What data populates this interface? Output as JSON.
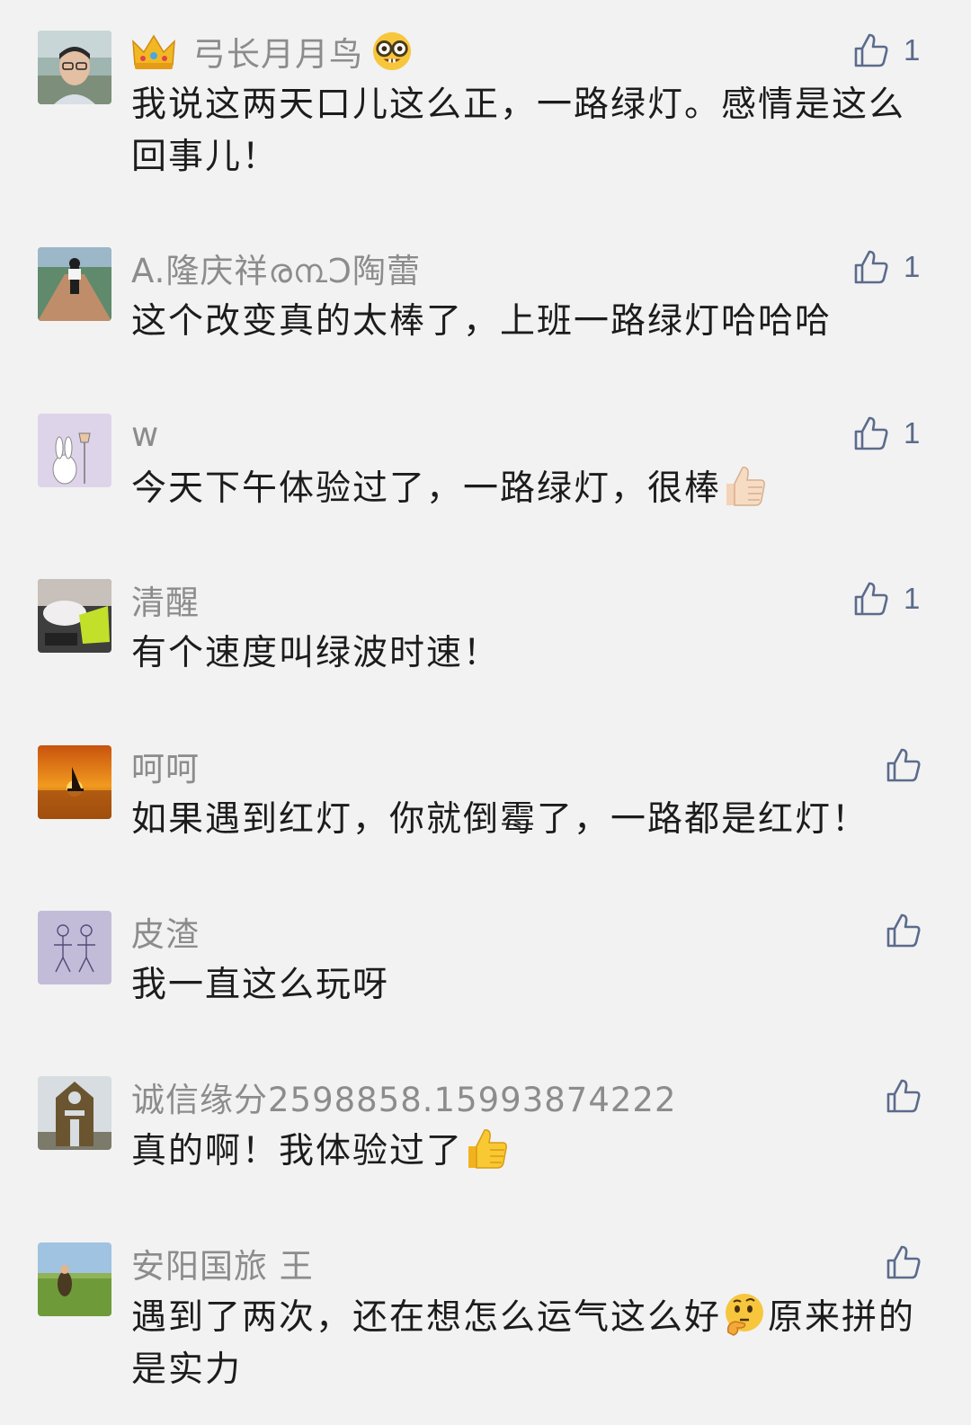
{
  "comments": [
    {
      "author": "弓长月月鸟",
      "text": "我说这两天口儿这么正，一路绿灯。感情是这么回事儿！",
      "likes": "1",
      "avatar_icon": "man-portrait-avatar",
      "name_prefix_icon": "crown-emoji",
      "name_suffix_icon": "nerd-face-emoji"
    },
    {
      "author": "A.隆庆祥ര൩ꓛ陶蕾",
      "text": "这个改变真的太棒了，上班一路绿灯哈哈哈",
      "likes": "1",
      "avatar_icon": "street-photo-avatar"
    },
    {
      "author": "w",
      "text_before": "今天下午体验过了，一路绿灯，很棒",
      "text_emoji": "thumbs-up-light-emoji",
      "likes": "1",
      "avatar_icon": "rabbit-cartoon-avatar"
    },
    {
      "author": "清醒",
      "text": "有个速度叫绿波时速！",
      "likes": "1",
      "avatar_icon": "cat-photo-avatar"
    },
    {
      "author": "呵呵",
      "text": "如果遇到红灯，你就倒霉了，一路都是红灯！",
      "likes": "",
      "avatar_icon": "sunset-sailboat-avatar"
    },
    {
      "author": "皮渣",
      "text": "我一直这么玩呀",
      "likes": "",
      "avatar_icon": "stick-figure-drawing-avatar"
    },
    {
      "author": "诚信缘分2598858.15993874222",
      "text_before": "真的啊！我体验过了",
      "text_emoji": "thumbs-up-yellow-emoji",
      "likes": "",
      "avatar_icon": "tower-photo-avatar"
    },
    {
      "author": "安阳国旅 王",
      "text_before": "遇到了两次，还在想怎么运气这么好",
      "text_emoji": "thinking-face-emoji",
      "text_after": "原来拼的是实力",
      "likes": "",
      "avatar_icon": "grassland-photo-avatar"
    }
  ],
  "colors": {
    "background": "#f2f2f2",
    "name": "#8c8c8c",
    "text": "#1c1c1c",
    "like_icon": "#5b6b8c"
  },
  "icons": {
    "like": "thumbs-up-outline-icon"
  }
}
